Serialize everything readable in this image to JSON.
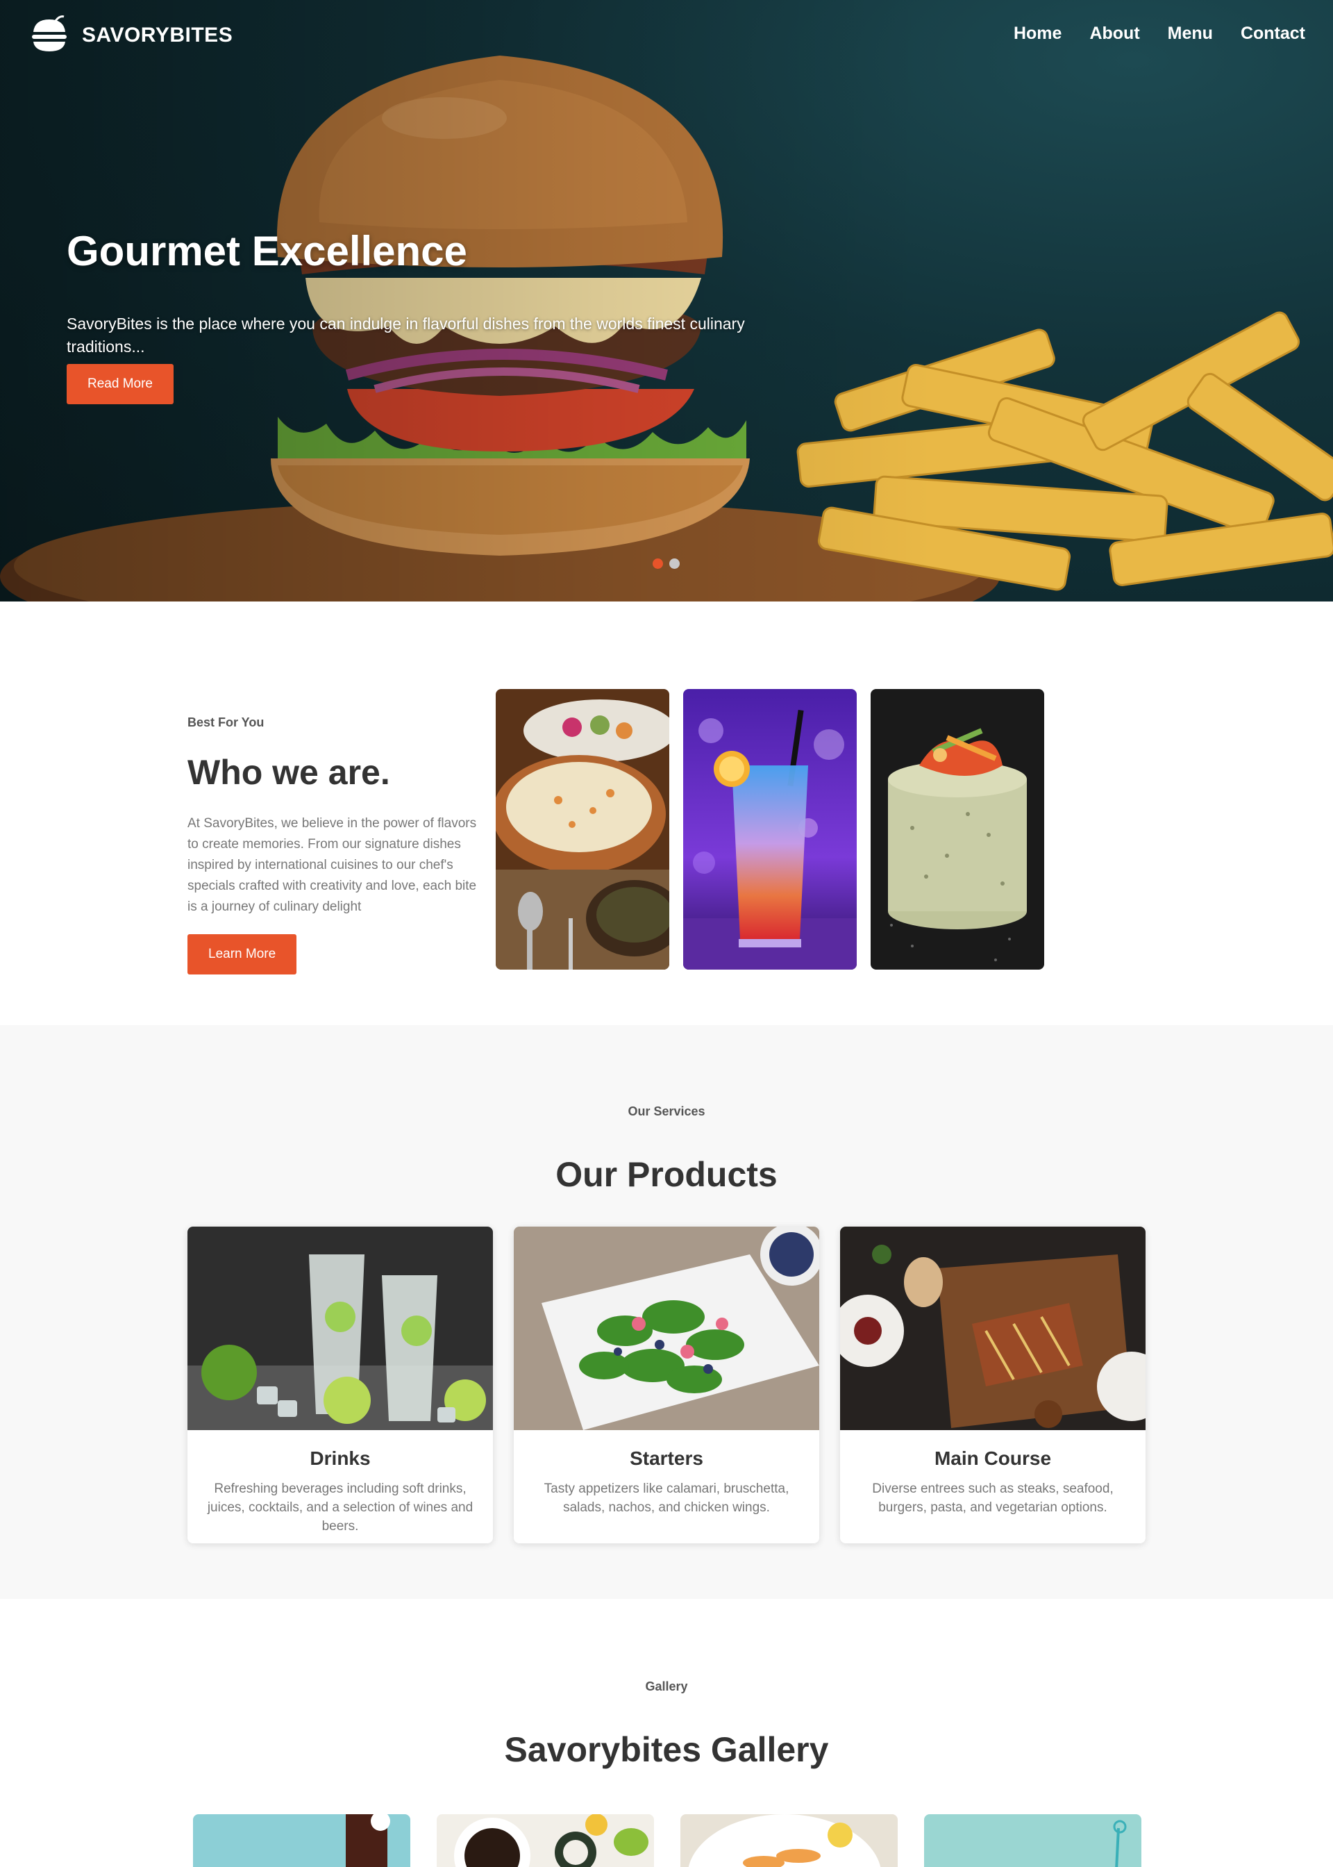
{
  "brand": {
    "name": "SAVORYBITES",
    "accent_color": "#e8542a"
  },
  "nav": {
    "items": [
      {
        "label": "Home"
      },
      {
        "label": "About"
      },
      {
        "label": "Menu"
      },
      {
        "label": "Contact"
      }
    ]
  },
  "hero": {
    "title": "Gourmet Excellence",
    "description": "SavoryBites is the place where you can indulge in flavorful dishes from the worlds finest culinary traditions...",
    "button_label": "Read More",
    "slide_count": 2,
    "active_slide": 1
  },
  "about": {
    "eyebrow": "Best For You",
    "title": "Who we are.",
    "description": "At SavoryBites, we believe in the power of flavors to create memories. From our signature dishes inspired by international cuisines to our chef's specials crafted with creativity and love, each bite is a journey of culinary delight",
    "button_label": "Learn More"
  },
  "products": {
    "eyebrow": "Our Services",
    "title": "Our Products",
    "items": [
      {
        "title": "Drinks",
        "description": "Refreshing beverages including soft drinks, juices, cocktails, and a selection of wines and beers."
      },
      {
        "title": "Starters",
        "description": "Tasty appetizers like calamari, bruschetta, salads, nachos, and chicken wings."
      },
      {
        "title": "Main Course",
        "description": "Diverse entrees such as steaks, seafood, burgers, pasta, and vegetarian options."
      }
    ]
  },
  "gallery": {
    "eyebrow": "Gallery",
    "title": "Savorybites Gallery"
  }
}
